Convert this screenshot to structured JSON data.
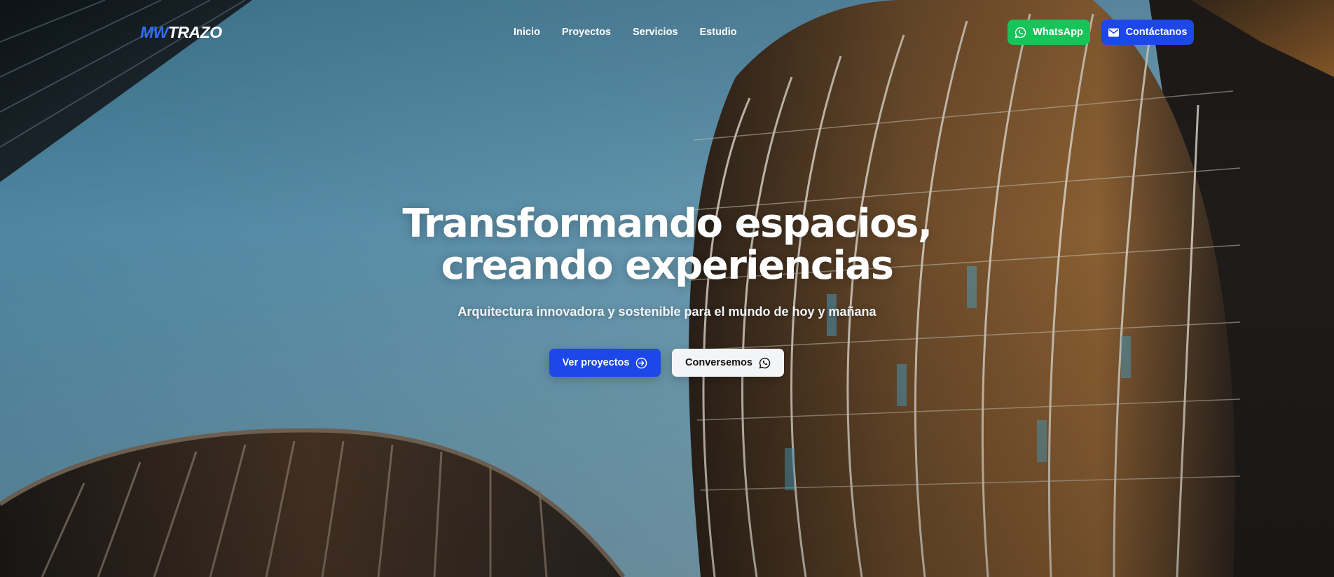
{
  "brand": {
    "logo_part1": "MW",
    "logo_part2": "TRAZO"
  },
  "nav": {
    "links": [
      {
        "label": "Inicio"
      },
      {
        "label": "Proyectos"
      },
      {
        "label": "Servicios"
      },
      {
        "label": "Estudio"
      }
    ],
    "whatsapp_label": "WhatsApp",
    "contact_label": "Contáctanos"
  },
  "hero": {
    "headline_line1": "Transformando espacios,",
    "headline_line2": "creando experiencias",
    "subtitle": "Arquitectura innovadora y sostenible para el mundo de hoy y mañana",
    "primary_cta": "Ver proyectos",
    "secondary_cta": "Conversemos"
  },
  "colors": {
    "accent_blue": "#1d47e8",
    "logo_blue": "#2f6bff",
    "whatsapp_green": "#17c45a",
    "sky": "#5a8ea8"
  },
  "icons": {
    "whatsapp": "whatsapp-icon",
    "contact": "mail-icon",
    "primary_cta": "arrow-right-circle-icon",
    "secondary_cta": "whatsapp-icon"
  }
}
